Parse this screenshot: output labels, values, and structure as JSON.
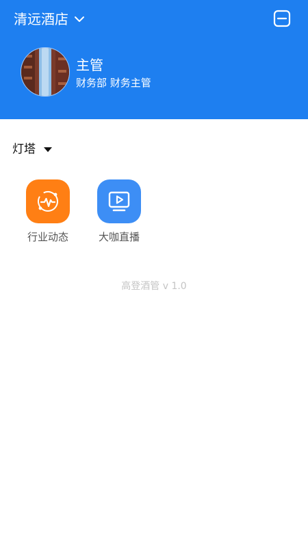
{
  "header": {
    "hotel_name": "清远酒店",
    "user_name": "主管",
    "user_department": "财务部 财务主管",
    "bg_color": "#1e7ff0"
  },
  "icons": {
    "hotel_dropdown": "chevron-down-icon",
    "menu": "minus-square-icon",
    "avatar": "user-avatar-photo"
  },
  "section": {
    "label": "灯塔",
    "toggle_icon": "caret-down-icon"
  },
  "apps": [
    {
      "label": "行业动态",
      "icon": "pulse-chart-icon",
      "color": "#ff7f14"
    },
    {
      "label": "大咖直播",
      "icon": "tv-play-icon",
      "color": "#3d8ef5"
    }
  ],
  "footer": {
    "version": "高登酒管 v 1.0"
  }
}
